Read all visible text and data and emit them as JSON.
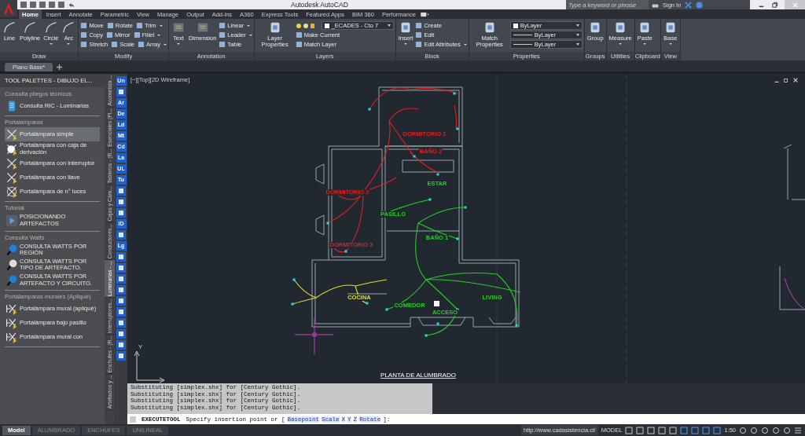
{
  "title_bar": {
    "title": "Autodesk AutoCAD",
    "search": {
      "placeholder": "Type a keyword or phrase"
    },
    "sign_in": "Sign In"
  },
  "ribbon_tabs": [
    {
      "label": "Home",
      "selected": true
    },
    {
      "label": "Insert",
      "selected": false
    },
    {
      "label": "Annotate",
      "selected": false
    },
    {
      "label": "Parametric",
      "selected": false
    },
    {
      "label": "View",
      "selected": false
    },
    {
      "label": "Manage",
      "selected": false
    },
    {
      "label": "Output",
      "selected": false
    },
    {
      "label": "Add-ins",
      "selected": false
    },
    {
      "label": "A360",
      "selected": false
    },
    {
      "label": "Express Tools",
      "selected": false
    },
    {
      "label": "Featured Apps",
      "selected": false
    },
    {
      "label": "BIM 360",
      "selected": false
    },
    {
      "label": "Performance",
      "selected": false
    }
  ],
  "ribbon_panels": [
    {
      "title": "Draw",
      "large": [
        {
          "label": "Line",
          "dropdown": false
        },
        {
          "label": "Polyline",
          "dropdown": false
        },
        {
          "label": "Circle",
          "dropdown": true
        },
        {
          "label": "Arc",
          "dropdown": true
        }
      ]
    },
    {
      "title": "Modify",
      "rows": [
        [
          {
            "label": "Move",
            "dropdown": false
          },
          {
            "label": "Rotate",
            "dropdown": false
          },
          {
            "label": "Trim",
            "dropdown": true
          }
        ],
        [
          {
            "label": "Copy",
            "dropdown": false
          },
          {
            "label": "Mirror",
            "dropdown": false
          },
          {
            "label": "Fillet",
            "dropdown": true
          }
        ],
        [
          {
            "label": "Stretch",
            "dropdown": false
          },
          {
            "label": "Scale",
            "dropdown": false
          },
          {
            "label": "Array",
            "dropdown": true
          }
        ]
      ]
    },
    {
      "title": "Annotation",
      "large": [
        {
          "label": "Text",
          "dropdown": true
        },
        {
          "label": "Dimension",
          "dropdown": false
        }
      ],
      "rows": [
        [
          {
            "label": "Linear",
            "dropdown": true
          }
        ],
        [
          {
            "label": "Leader",
            "dropdown": true
          }
        ],
        [
          {
            "label": "Table",
            "dropdown": false
          }
        ]
      ]
    },
    {
      "title": "Layers",
      "large": [
        {
          "label": "Layer Properties",
          "dropdown": false
        }
      ],
      "combos": [
        {
          "kind": "layer",
          "value": "_ECADES - Cto 7"
        }
      ],
      "rows": [
        [
          {
            "label": "Make Current",
            "dropdown": false
          }
        ],
        [
          {
            "label": "Match Layer",
            "dropdown": false
          }
        ]
      ]
    },
    {
      "title": "Block",
      "large": [
        {
          "label": "Insert",
          "dropdown": true
        }
      ],
      "rows": [
        [
          {
            "label": "Create",
            "dropdown": false
          }
        ],
        [
          {
            "label": "Edit",
            "dropdown": false
          }
        ],
        [
          {
            "label": "Edit Attributes",
            "dropdown": true
          }
        ]
      ]
    },
    {
      "title": "Properties",
      "large": [
        {
          "label": "Match Properties",
          "dropdown": false
        }
      ],
      "combos": [
        {
          "kind": "color",
          "value": "ByLayer"
        },
        {
          "kind": "linetype",
          "value": "ByLayer"
        },
        {
          "kind": "lineweight",
          "value": "ByLayer"
        }
      ]
    },
    {
      "title": "Groups",
      "large": [
        {
          "label": "Group",
          "dropdown": false
        }
      ]
    },
    {
      "title": "Utilities",
      "large": [
        {
          "label": "Measure",
          "dropdown": true
        }
      ]
    },
    {
      "title": "Clipboard",
      "large": [
        {
          "label": "Paste",
          "dropdown": true
        }
      ]
    },
    {
      "title": "View",
      "large": [
        {
          "label": "Base",
          "dropdown": true
        }
      ]
    }
  ],
  "document_tabs": [
    {
      "label": "Plano Base*",
      "selected": true
    }
  ],
  "tool_palette": {
    "title": "TOOL PALETTES - DIBUJO EL...",
    "sections": [
      {
        "title": "Consulta pliegos técnicos",
        "kind": "document",
        "items": [
          {
            "label": "Consulta RIC - Luminarias",
            "selected": false
          }
        ]
      },
      {
        "title": "Portalamparas",
        "kind": "lamp",
        "items": [
          {
            "label": "Portalámpara simple",
            "selected": true
          },
          {
            "label": "Portalámpara con caja de derivación",
            "selected": false
          },
          {
            "label": "Portalámpara con interruptor",
            "selected": false
          },
          {
            "label": "Portalámpara con llave",
            "selected": false
          },
          {
            "label": "Portalámpara de n° luces",
            "selected": false
          }
        ]
      },
      {
        "title": "Tutorial",
        "kind": "tutorial",
        "items": [
          {
            "label": "POSICIONANDO ARTEFACTOS",
            "selected": false
          }
        ]
      },
      {
        "title": "Consulta Watts",
        "kind": "watts",
        "items": [
          {
            "label": "CONSULTA WATTS POR REGIÓN",
            "selected": false
          },
          {
            "label": "CONSULTA WATTS POR TIPO DE ARTEFACTO.",
            "selected": false
          },
          {
            "label": "CONSULTA WATTS POR ARTEFACTO Y CIRCUITO.",
            "selected": false
          }
        ]
      },
      {
        "title": "Portalamparas murales (Apliqué)",
        "kind": "wall-lamp",
        "items": [
          {
            "label": "Portalámpara mural (apliqué)",
            "selected": false
          },
          {
            "label": "Portalámpara bajo pasillo",
            "selected": false
          },
          {
            "label": "Portalámpara mural con",
            "selected": false
          }
        ]
      }
    ],
    "side_tabs": [
      {
        "label": "Acometida ...",
        "selected": false
      },
      {
        "label": "Esenciales (Pl...",
        "selected": false
      },
      {
        "label": "Tableros - (R...",
        "selected": false
      },
      {
        "label": "Cajas y Cám...",
        "selected": false
      },
      {
        "label": "Conductores...",
        "selected": false
      },
      {
        "label": "Luminarias - ...",
        "selected": true
      },
      {
        "label": "Interruptores...",
        "selected": false
      },
      {
        "label": "Enchufes - (R...",
        "selected": false
      },
      {
        "label": "Artefactos y ...",
        "selected": false
      }
    ]
  },
  "side_toolbar": [
    {
      "kind": "text",
      "label": "Un"
    },
    {
      "kind": "icon"
    },
    {
      "kind": "text",
      "label": "Ar"
    },
    {
      "kind": "text",
      "label": "De"
    },
    {
      "kind": "text",
      "label": "Ld"
    },
    {
      "kind": "text",
      "label": "Mt"
    },
    {
      "kind": "text",
      "label": "Cd"
    },
    {
      "kind": "text",
      "label": "La"
    },
    {
      "kind": "text",
      "label": "UL"
    },
    {
      "kind": "text",
      "label": "Tu"
    },
    {
      "kind": "icon"
    },
    {
      "kind": "icon"
    },
    {
      "kind": "icon"
    },
    {
      "kind": "text",
      "label": "ID"
    },
    {
      "kind": "icon"
    },
    {
      "kind": "text",
      "label": "Lg"
    },
    {
      "kind": "icon"
    },
    {
      "kind": "icon"
    },
    {
      "kind": "icon"
    },
    {
      "kind": "icon"
    },
    {
      "kind": "icon"
    },
    {
      "kind": "icon"
    },
    {
      "kind": "icon"
    },
    {
      "kind": "icon"
    },
    {
      "kind": "icon"
    },
    {
      "kind": "icon"
    }
  ],
  "viewport": {
    "label": "[−][Top][2D Wireframe]",
    "rooms": [
      {
        "name": "DORMITORIO 1",
        "color": "#e02020"
      },
      {
        "name": "BAÑO 2",
        "color": "#e02020"
      },
      {
        "name": "ESTAR",
        "color": "#20d020"
      },
      {
        "name": "DORMITORIO 2",
        "color": "#e02020"
      },
      {
        "name": "PASILLO",
        "color": "#20d020"
      },
      {
        "name": "BAÑO 1",
        "color": "#20d020"
      },
      {
        "name": "DORMITORIO 3",
        "color": "#e02020"
      },
      {
        "name": "COCINA",
        "color": "#e0e020"
      },
      {
        "name": "COMEDOR",
        "color": "#20d020"
      },
      {
        "name": "ACCESO",
        "color": "#20d020"
      },
      {
        "name": "LIVING",
        "color": "#20d020"
      }
    ],
    "plan_title": "PLANTA DE ALUMBRADO",
    "ucs": {
      "y": "Y"
    }
  },
  "command_history": [
    "Substituting [simplex.shx] for [Century Gothic].",
    "Substituting [simplex.shx] for [Century Gothic].",
    "Substituting [simplex.shx] for [Century Gothic].",
    "Substituting [simplex.shx] for [Century Gothic]."
  ],
  "command_line": {
    "command": "EXECUTETOOL",
    "prompt": "Specify insertion point or [",
    "options": [
      "Basepoint",
      "Scale",
      "X",
      "Y",
      "Z",
      "Rotate"
    ],
    "end": "]:"
  },
  "layout_tabs": [
    {
      "label": "Model",
      "selected": true
    },
    {
      "label": "ALUMBRADO",
      "selected": false
    },
    {
      "label": "ENCHUFES",
      "selected": false
    },
    {
      "label": "UNILINEAL",
      "selected": false
    }
  ],
  "status_bar": {
    "url": "http://www.cadasistencia.cl/",
    "space": "MODEL",
    "scale": "1:50"
  }
}
